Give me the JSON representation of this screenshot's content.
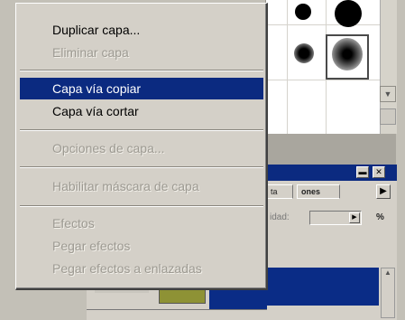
{
  "context_menu": {
    "items": [
      {
        "label": "Duplicar capa...",
        "enabled": true
      },
      {
        "label": "Eliminar capa",
        "enabled": false
      },
      {
        "label": "Capa vía copiar",
        "enabled": true,
        "highlighted": true
      },
      {
        "label": "Capa vía cortar",
        "enabled": true
      },
      {
        "label": "Opciones de capa...",
        "enabled": false
      },
      {
        "label": "Habilitar máscara de capa",
        "enabled": false
      },
      {
        "label": "Efectos",
        "enabled": false
      },
      {
        "label": "Pegar efectos",
        "enabled": false
      },
      {
        "label": "Pegar efectos a enlazadas",
        "enabled": false
      }
    ]
  },
  "layers_panel": {
    "tabs": [
      "ta",
      "ones"
    ],
    "opacity_label": "idad:",
    "opacity_unit": "%"
  },
  "colors": {
    "highlight": "#0b2a80",
    "menu_bg": "#d4d0c8",
    "disabled_text": "#9d9a92",
    "layer_thumb": "#8a8d34"
  }
}
